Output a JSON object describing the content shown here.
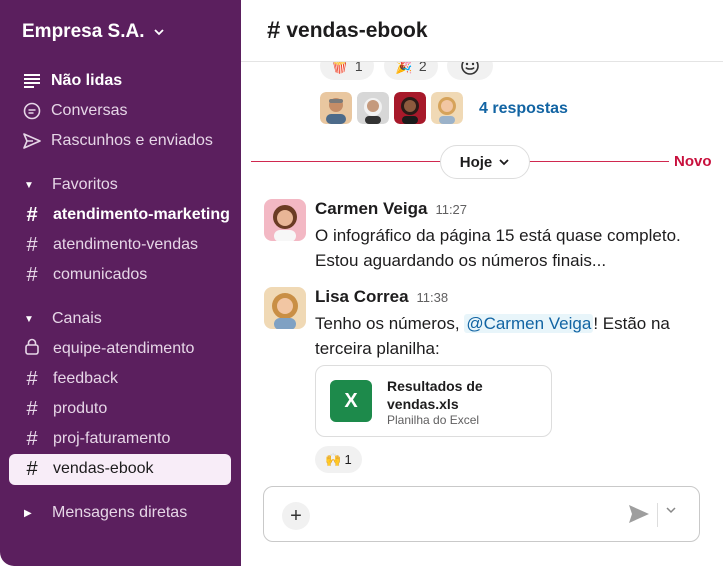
{
  "workspace": {
    "name": "Empresa S.A."
  },
  "sidebar": {
    "top_items": [
      {
        "label": "Não lidas",
        "icon": "unread-icon"
      },
      {
        "label": "Conversas",
        "icon": "threads-icon"
      },
      {
        "label": "Rascunhos e enviados",
        "icon": "send-icon"
      }
    ],
    "sections": {
      "favorites": "Favoritos",
      "channels": "Canais",
      "dms": "Mensagens diretas"
    },
    "favorite_channels": [
      "atendimento-marketing",
      "atendimento-vendas",
      "comunicados"
    ],
    "channels": [
      "equipe-atendimento",
      "feedback",
      "produto",
      "proj-faturamento",
      "vendas-ebook"
    ]
  },
  "channel": {
    "title": "vendas-ebook"
  },
  "thread_summary": {
    "reactions": [
      {
        "emoji": "🍿",
        "count": "1"
      },
      {
        "emoji": "🎉",
        "count": "2"
      }
    ],
    "replies": "4 respostas"
  },
  "divider": {
    "label": "Hoje",
    "new_label": "Novo"
  },
  "messages": [
    {
      "author": "Carmen Veiga",
      "time": "11:27",
      "text": "O infográfico da página 15 está quase completo. Estou aguardando os números finais..."
    },
    {
      "author": "Lisa Correa",
      "time": "11:38",
      "text_before": "Tenho os números, ",
      "mention": "@Carmen Veiga",
      "text_after": "! Estão na terceira planilha:",
      "file": {
        "name": "Resultados de vendas.xls",
        "type": "Planilha do Excel"
      },
      "reaction": {
        "emoji": "🙌",
        "count": "1"
      }
    }
  ],
  "colors": {
    "sidebar": "#5b1f5e",
    "accent": "#1264a3",
    "new_line": "#c8103d",
    "excel": "#1d8a4b"
  }
}
